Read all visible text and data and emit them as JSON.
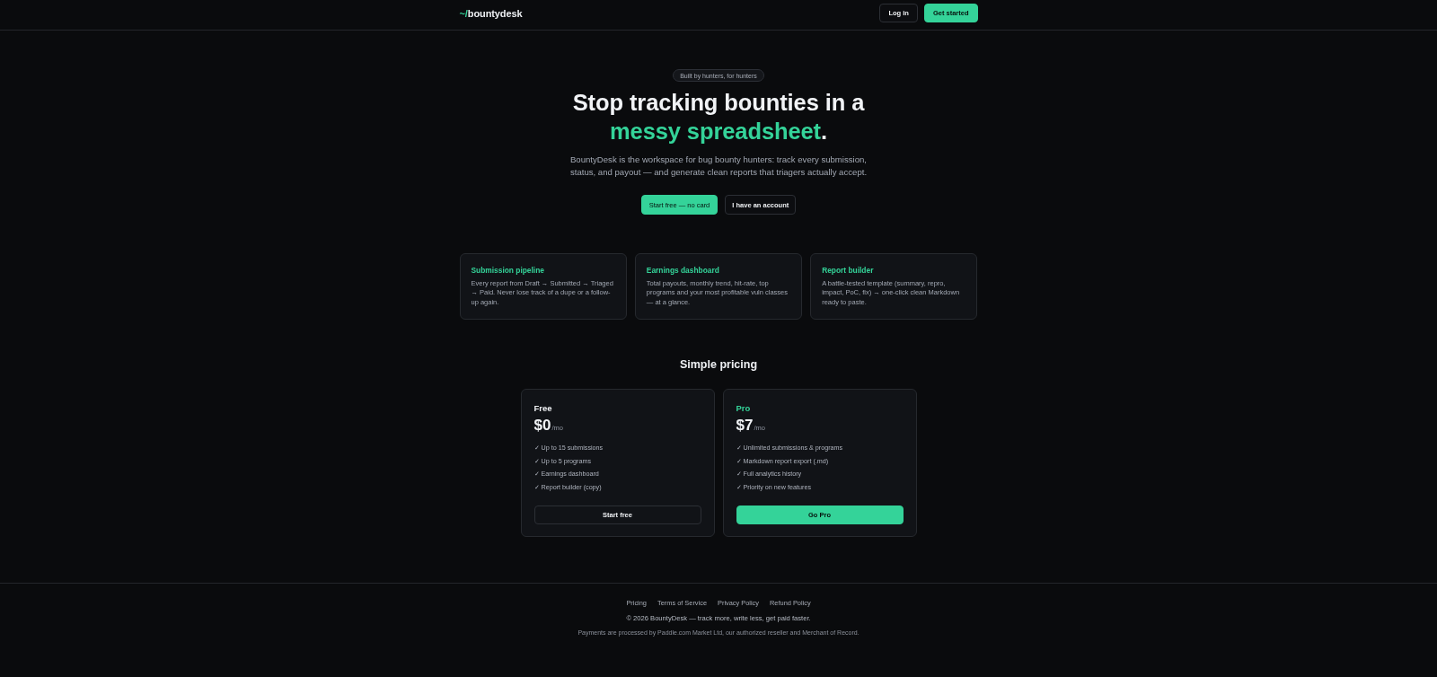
{
  "header": {
    "logo": {
      "prefix": "~/",
      "name": "bountydesk"
    },
    "login_button": "Log in",
    "signup_button": "Get started"
  },
  "hero": {
    "badge": "Built by hunters, for hunters",
    "heading": {
      "text": "Stop tracking bounties in a",
      "highlight": "messy spreadsheet",
      "end": "."
    },
    "description": "BountyDesk is the workspace for bug bounty hunters: track every submission, status, and payout — and generate clean reports that triagers actually accept.",
    "primary_button": "Start free — no card",
    "secondary_button": "I have an account"
  },
  "features": [
    {
      "title": "Submission pipeline",
      "text": "Every report from Draft → Submitted → Triaged → Paid. Never lose track of a dupe or a follow-up again."
    },
    {
      "title": "Earnings dashboard",
      "text": "Total payouts, monthly trend, hit-rate, top programs and your most profitable vuln classes — at a glance."
    },
    {
      "title": "Report builder",
      "text": "A battle-tested template (summary, repro, impact, PoC, fix) → one-click clean Markdown ready to paste."
    }
  ],
  "pricing": {
    "title": "Simple pricing",
    "plans": [
      {
        "name": "Free",
        "featured": false,
        "price": "$0",
        "period": "/mo",
        "features": [
          "✓ Up to 15 submissions",
          "✓ Up to 5 programs",
          "✓ Earnings dashboard",
          "✓ Report builder (copy)"
        ],
        "button": "Start free"
      },
      {
        "name": "Pro",
        "featured": true,
        "price": "$7",
        "period": "/mo",
        "features": [
          "✓ Unlimited submissions & programs",
          "✓ Markdown report export (.md)",
          "✓ Full analytics history",
          "✓ Priority on new features"
        ],
        "button": "Go Pro"
      }
    ]
  },
  "footer": {
    "links": [
      "Pricing",
      "Terms of Service",
      "Privacy Policy",
      "Refund Policy"
    ],
    "copyright": "© 2026 BountyDesk — track more, write less, get paid faster.",
    "note": "Payments are processed by Paddle.com Market Ltd, our authorized reseller and Merchant of Record."
  }
}
